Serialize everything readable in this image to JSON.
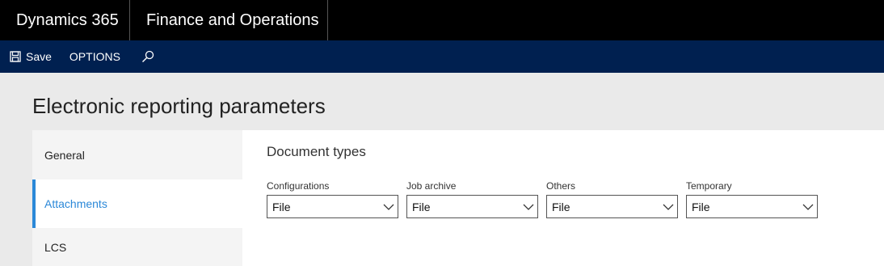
{
  "topbar": {
    "brand": "Dynamics 365",
    "app_name": "Finance and Operations"
  },
  "actionbar": {
    "save_label": "Save",
    "options_label": "OPTIONS"
  },
  "page": {
    "title": "Electronic reporting parameters"
  },
  "tabs": [
    {
      "label": "General",
      "active": false
    },
    {
      "label": "Attachments",
      "active": true
    },
    {
      "label": "LCS",
      "active": false
    }
  ],
  "document_types": {
    "title": "Document types",
    "fields": [
      {
        "label": "Configurations",
        "value": "File"
      },
      {
        "label": "Job archive",
        "value": "File"
      },
      {
        "label": "Others",
        "value": "File"
      },
      {
        "label": "Temporary",
        "value": "File"
      }
    ]
  },
  "colors": {
    "topbar": "#000000",
    "actionbar": "#002050",
    "accent": "#2b88d8"
  }
}
